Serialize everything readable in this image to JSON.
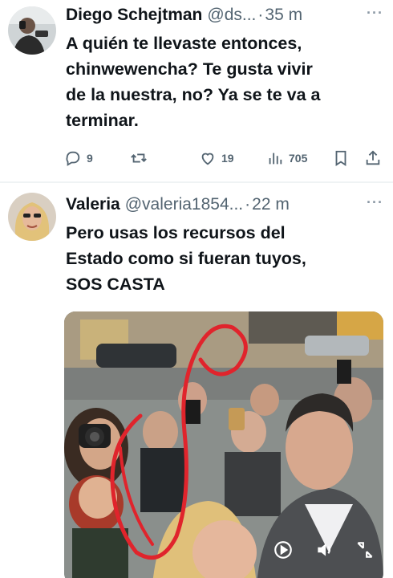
{
  "tweets": [
    {
      "name": "Diego Schejtman",
      "handle": "@ds...",
      "separator": "·",
      "time": "35 m",
      "more": "···",
      "text_lines": [
        "A quién te llevaste entonces,",
        "chinwewencha? Te gusta vivir",
        "de la nuestra, no? Ya se te va a",
        "terminar."
      ],
      "actions": {
        "replies": "9",
        "retweets": "",
        "likes": "19",
        "views": "705"
      },
      "icons": [
        "reply-icon",
        "retweet-icon",
        "like-icon",
        "views-icon",
        "bookmark-icon",
        "share-icon"
      ]
    },
    {
      "name": "Valeria",
      "handle": "@valeria1854...",
      "separator": "·",
      "time": "22 m",
      "more": "···",
      "text_lines": [
        "Pero usas los recursos del",
        "Estado como si fueran tuyos,",
        "SOS CASTA"
      ],
      "media": {
        "type": "video",
        "controls": [
          "play-icon",
          "volume-icon",
          "fullscreen-exit-icon"
        ]
      }
    }
  ],
  "colors": {
    "text": "#0f1419",
    "secondary": "#536471",
    "divider": "#eff3f4",
    "annotation_circle": "#e0242c"
  }
}
